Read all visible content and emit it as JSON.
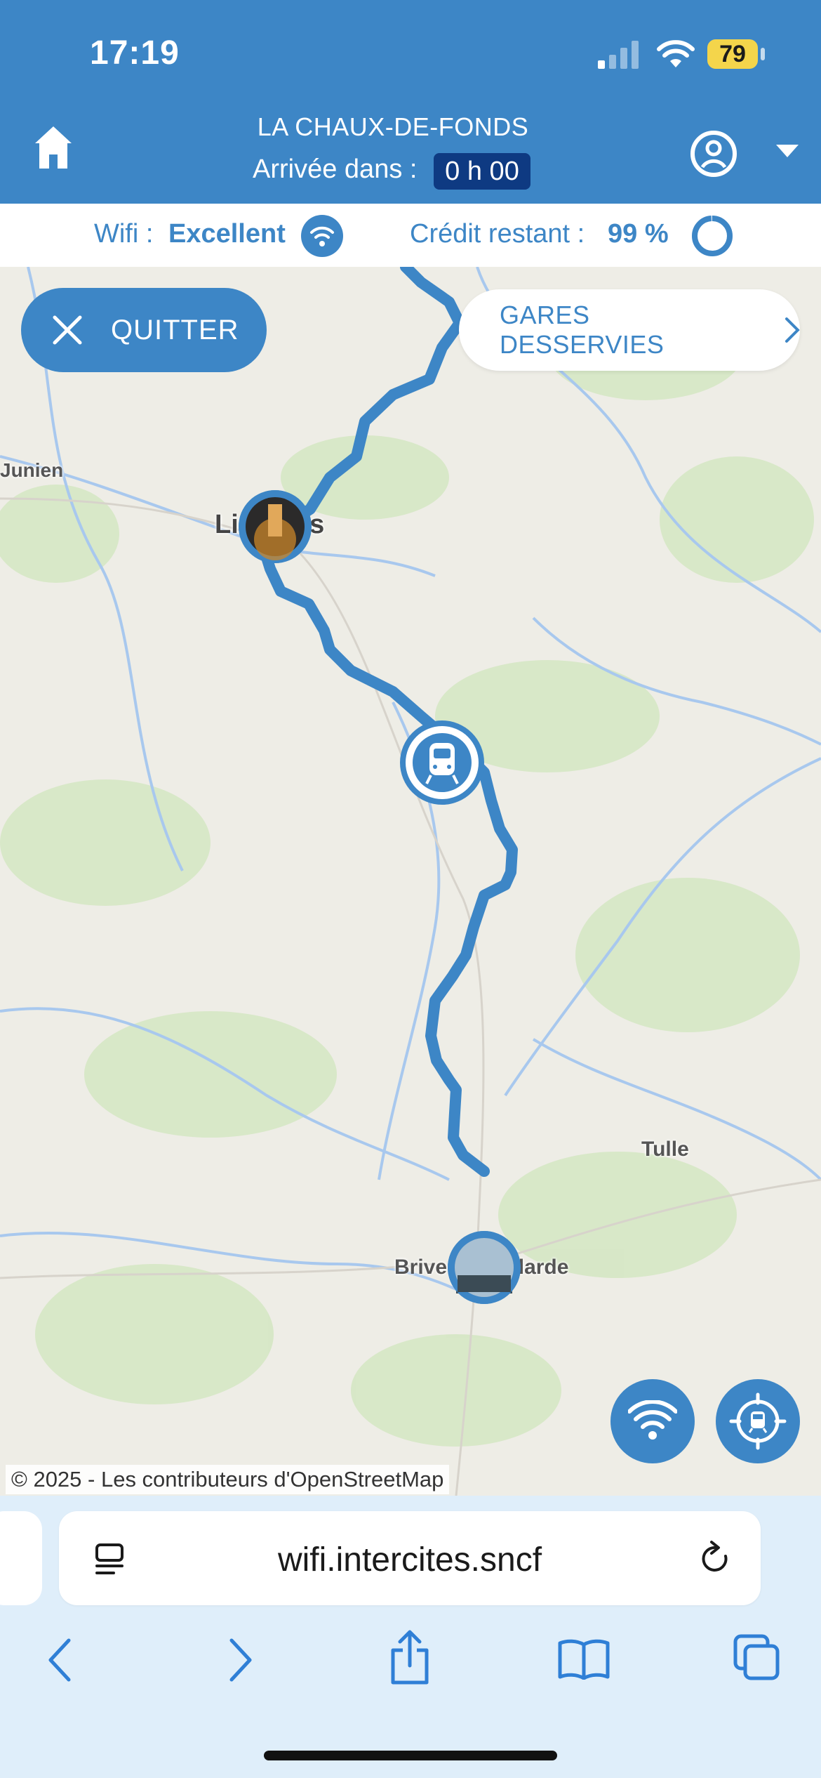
{
  "status_bar": {
    "time": "17:19",
    "battery": "79",
    "icons": [
      "signal-icon",
      "wifi-icon",
      "battery-icon"
    ]
  },
  "header": {
    "destination": "LA CHAUX-DE-FONDS",
    "arrival_label": "Arrivée dans :",
    "arrival_value": "0 h 00",
    "icons": [
      "home-icon",
      "user-icon",
      "dropdown-arrow-icon"
    ]
  },
  "info_bar": {
    "wifi_label": "Wifi :",
    "wifi_value": "Excellent",
    "credit_label": "Crédit restant :",
    "credit_value": "99 %",
    "credit_fraction": 0.99
  },
  "map": {
    "quit_label": "QUITTER",
    "stations_label": "GARES DESSERVIES",
    "labels": {
      "junien": "Junien",
      "limoges": "Limoges",
      "tulle": "Tulle",
      "brive": "Brive-la-Gaillarde"
    },
    "copyright": "© 2025 - Les contributeurs d'OpenStreetMap",
    "route_color": "#3d86c6"
  },
  "browser": {
    "url": "wifi.intercites.sncf",
    "icons": [
      "reader-icon",
      "reload-icon",
      "back-icon",
      "forward-icon",
      "share-icon",
      "bookmarks-icon",
      "tabs-icon"
    ]
  }
}
